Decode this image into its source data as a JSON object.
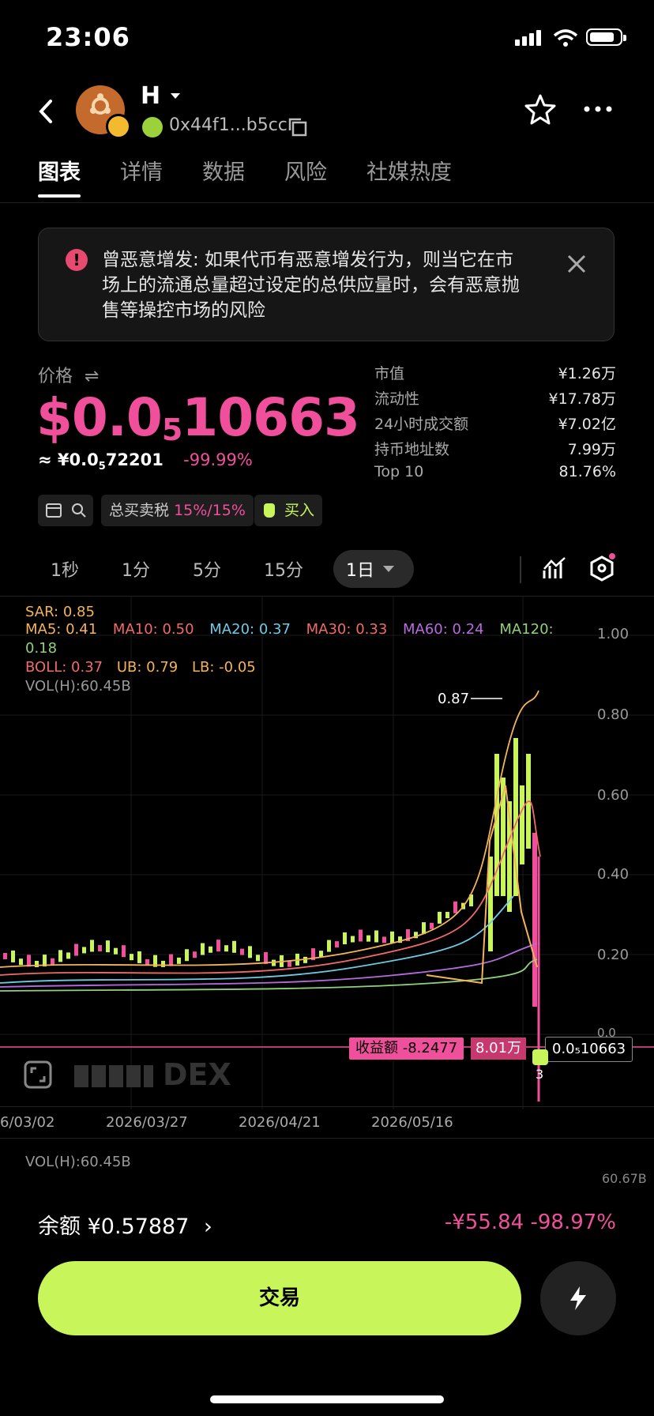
{
  "status": {
    "time": "23:06"
  },
  "header": {
    "token_symbol": "H",
    "contract": "0x44f1...b5cc"
  },
  "tabs": [
    "图表",
    "详情",
    "数据",
    "风险",
    "社媒热度"
  ],
  "warning": {
    "text": "曾恶意增发: 如果代币有恶意增发行为，则当它在市场上的流通总量超过设定的总供应量时，会有恶意抛售等操控市场的风险"
  },
  "price": {
    "label": "价格",
    "usd_prefix": "$0.0",
    "usd_sub": "5",
    "usd_rest": "10663",
    "cny_prefix": "≈ ¥0.0",
    "cny_sub": "5",
    "cny_rest": "72201",
    "change": "-99.99%"
  },
  "stats": [
    {
      "label": "市值",
      "value": "¥1.26万"
    },
    {
      "label": "流动性",
      "value": "¥17.78万"
    },
    {
      "label": "24小时成交额",
      "value": "¥7.02亿"
    },
    {
      "label": "持币地址数",
      "value": "7.99万"
    },
    {
      "label": "Top 10",
      "value": "81.76%"
    }
  ],
  "tax": {
    "label": "总买卖税",
    "value": "15%/15%"
  },
  "buy_label": "买入",
  "timeframes": [
    "1秒",
    "1分",
    "5分",
    "15分",
    "1日"
  ],
  "indicators": {
    "sar": "SAR: 0.85",
    "ma5_label": "MA5:",
    "ma5": "0.41",
    "ma10_label": "MA10:",
    "ma10": "0.50",
    "ma20_label": "MA20:",
    "ma20": "0.37",
    "ma30_label": "MA30:",
    "ma30": "0.33",
    "ma60_label": "MA60:",
    "ma60": "0.24",
    "ma120_label": "MA120:",
    "ma120": "0.18",
    "boll": "BOLL: 0.37",
    "ub": "UB: 0.79",
    "lb": "LB: -0.05",
    "vol": "VOL(H):60.45B",
    "vol2": "VOL(H):60.45B",
    "vol_axis": "60.67B"
  },
  "chart_data": {
    "type": "candlestick",
    "y_ticks": [
      "1.00",
      "0.80",
      "0.60",
      "0.40",
      "0.20",
      "0.0"
    ],
    "x_ticks": [
      "6/03/02",
      "2026/03/27",
      "2026/04/21",
      "2026/05/16"
    ],
    "ylim": [
      0,
      1.0
    ],
    "high_annotation": "0.87",
    "current_price_label": "0.0₅10663",
    "pnl_label": "收益额 -8.2477",
    "pnl_value": "8.01万",
    "marker_count": "3",
    "watermark": "DEX"
  },
  "balance": {
    "label": "余额 ¥0.57887",
    "pnl": "-¥55.84 -98.97%"
  },
  "trade_label": "交易",
  "colors": {
    "accent": "#c8f55a",
    "pink": "#f0509b"
  }
}
